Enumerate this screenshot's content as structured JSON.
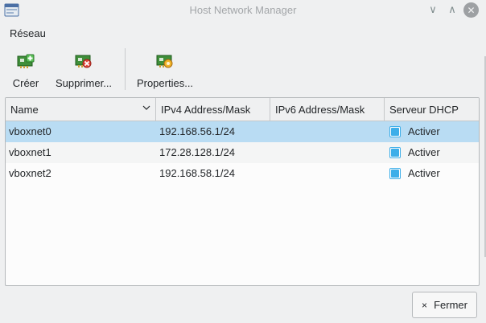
{
  "window": {
    "title": "Host Network Manager",
    "minimize_glyph": "∨",
    "maximize_glyph": "∧",
    "close_glyph": "✕"
  },
  "menubar": {
    "items": [
      {
        "label": "Réseau"
      }
    ]
  },
  "toolbar": {
    "create_label": "Créer",
    "remove_label": "Supprimer...",
    "properties_label": "Properties...",
    "icons": [
      "network-card-add-icon",
      "network-card-remove-icon",
      "network-card-properties-icon"
    ]
  },
  "table": {
    "headers": {
      "name": "Name",
      "ipv4": "IPv4 Address/Mask",
      "ipv6": "IPv6 Address/Mask",
      "dhcp": "Serveur DHCP"
    },
    "rows": [
      {
        "name": "vboxnet0",
        "ipv4": "192.168.56.1/24",
        "ipv6": "",
        "dhcp_label": "Activer",
        "dhcp_enabled": true,
        "selected": true
      },
      {
        "name": "vboxnet1",
        "ipv4": "172.28.128.1/24",
        "ipv6": "",
        "dhcp_label": "Activer",
        "dhcp_enabled": true,
        "selected": false
      },
      {
        "name": "vboxnet2",
        "ipv4": "192.168.58.1/24",
        "ipv6": "",
        "dhcp_label": "Activer",
        "dhcp_enabled": true,
        "selected": false
      }
    ]
  },
  "footer": {
    "close_label": "Fermer",
    "close_glyph": "×"
  },
  "colors": {
    "accent": "#3daee9",
    "selection": "#b9dcf3",
    "window_bg": "#eff0f1"
  }
}
